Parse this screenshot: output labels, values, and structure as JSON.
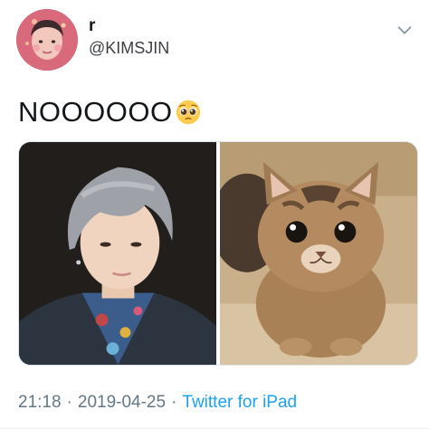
{
  "user": {
    "display_name": "r",
    "handle": "@KIMSJIN"
  },
  "tweet": {
    "text": "NOOOOOO",
    "emoji": "pleading-face-emoji"
  },
  "media": {
    "count": 2,
    "items": [
      {
        "subject": "person-photo"
      },
      {
        "subject": "kitten-photo"
      }
    ]
  },
  "footer": {
    "time": "21:18",
    "separator": "·",
    "date": "2019-04-25",
    "source": "Twitter for iPad"
  },
  "colors": {
    "link": "#1da1f2",
    "meta": "#657786",
    "text": "#14171a"
  }
}
